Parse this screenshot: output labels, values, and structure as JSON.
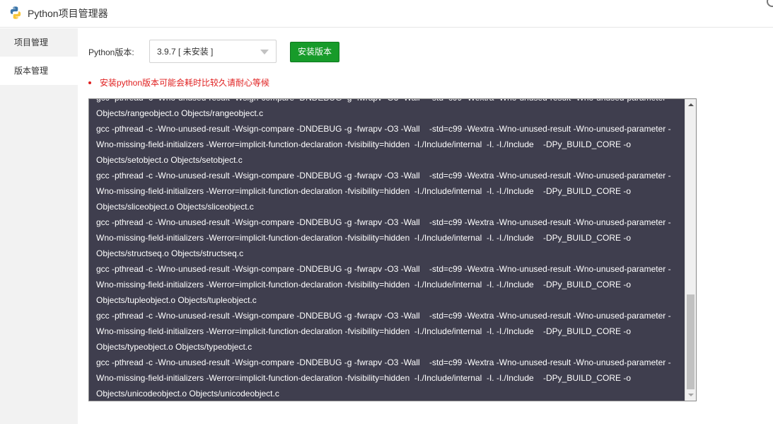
{
  "app": {
    "title": "Python项目管理器"
  },
  "sidebar": {
    "items": [
      {
        "label": "项目管理",
        "active": false
      },
      {
        "label": "版本管理",
        "active": true
      }
    ]
  },
  "version_panel": {
    "python_label": "Python版本:",
    "selected_version": "3.9.7 [ 未安装 ]",
    "install_button": "安装版本",
    "warning": "安装python版本可能会耗时比较久请耐心等候"
  },
  "log": {
    "lines": [
      "gcc -pthread -c -Wno-unused-result -Wsign-compare -DNDEBUG -g -fwrapv -O3 -Wall    -std=c99 -Wextra -Wno-unused-result -Wno-unused-parameter -",
      "Objects/rangeobject.o Objects/rangeobject.c",
      "gcc -pthread -c -Wno-unused-result -Wsign-compare -DNDEBUG -g -fwrapv -O3 -Wall    -std=c99 -Wextra -Wno-unused-result -Wno-unused-parameter -",
      "Wno-missing-field-initializers -Werror=implicit-function-declaration -fvisibility=hidden  -I./Include/internal  -I. -I./Include    -DPy_BUILD_CORE -o",
      "Objects/setobject.o Objects/setobject.c",
      "gcc -pthread -c -Wno-unused-result -Wsign-compare -DNDEBUG -g -fwrapv -O3 -Wall    -std=c99 -Wextra -Wno-unused-result -Wno-unused-parameter -",
      "Wno-missing-field-initializers -Werror=implicit-function-declaration -fvisibility=hidden  -I./Include/internal  -I. -I./Include    -DPy_BUILD_CORE -o",
      "Objects/sliceobject.o Objects/sliceobject.c",
      "gcc -pthread -c -Wno-unused-result -Wsign-compare -DNDEBUG -g -fwrapv -O3 -Wall    -std=c99 -Wextra -Wno-unused-result -Wno-unused-parameter -",
      "Wno-missing-field-initializers -Werror=implicit-function-declaration -fvisibility=hidden  -I./Include/internal  -I. -I./Include    -DPy_BUILD_CORE -o",
      "Objects/structseq.o Objects/structseq.c",
      "gcc -pthread -c -Wno-unused-result -Wsign-compare -DNDEBUG -g -fwrapv -O3 -Wall    -std=c99 -Wextra -Wno-unused-result -Wno-unused-parameter -",
      "Wno-missing-field-initializers -Werror=implicit-function-declaration -fvisibility=hidden  -I./Include/internal  -I. -I./Include    -DPy_BUILD_CORE -o",
      "Objects/tupleobject.o Objects/tupleobject.c",
      "gcc -pthread -c -Wno-unused-result -Wsign-compare -DNDEBUG -g -fwrapv -O3 -Wall    -std=c99 -Wextra -Wno-unused-result -Wno-unused-parameter -",
      "Wno-missing-field-initializers -Werror=implicit-function-declaration -fvisibility=hidden  -I./Include/internal  -I. -I./Include    -DPy_BUILD_CORE -o",
      "Objects/typeobject.o Objects/typeobject.c",
      "gcc -pthread -c -Wno-unused-result -Wsign-compare -DNDEBUG -g -fwrapv -O3 -Wall    -std=c99 -Wextra -Wno-unused-result -Wno-unused-parameter -",
      "Wno-missing-field-initializers -Werror=implicit-function-declaration -fvisibility=hidden  -I./Include/internal  -I. -I./Include    -DPy_BUILD_CORE -o",
      "Objects/unicodeobject.o Objects/unicodeobject.c"
    ]
  },
  "colors": {
    "install_button": "#179b2a",
    "warning_text": "#e02020",
    "log_background": "#3f3e4e",
    "sidebar_background": "#f2f2f2"
  }
}
